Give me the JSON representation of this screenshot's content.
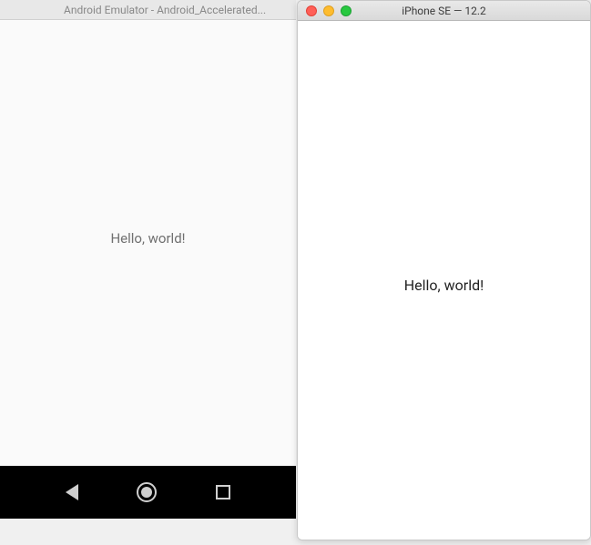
{
  "android": {
    "title": "Android Emulator - Android_Accelerated...",
    "hello_text": "Hello, world!",
    "nav": {
      "back": "back-triangle",
      "home": "home-circle",
      "recent": "recent-square"
    }
  },
  "iphone": {
    "title": "iPhone SE — 12.2",
    "hello_text": "Hello, world!",
    "traffic_lights": {
      "close": "#ff5f57",
      "minimize": "#febc2e",
      "zoom": "#28c840"
    }
  }
}
